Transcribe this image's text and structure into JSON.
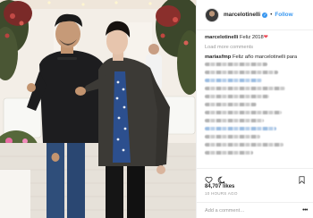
{
  "post": {
    "username": "marcelotinelli",
    "verified_badge": "verified-badge-icon",
    "separator": "•",
    "follow_label": "Follow",
    "load_more": "Load more comments",
    "caption_username": "marcelotinelli",
    "caption_text": "Feliz 2018",
    "caption_emoji": "❤",
    "comment_user_1": "mariasfmp",
    "comment_text_1": "Feliz año marcelotinelli para",
    "likes": "84,707 likes",
    "timestamp": "10 HOURS AGO",
    "add_comment_placeholder": "Add a comment…",
    "more_options": "•••"
  },
  "icons": [
    "heart-icon",
    "comment-icon",
    "bookmark-icon",
    "more-options-icon",
    "verified-badge-icon"
  ],
  "colors": {
    "link_blue": "#3897f0",
    "text_dark": "#262626",
    "text_gray": "#999999",
    "heart_red": "#ed4956",
    "border": "#efefef"
  }
}
